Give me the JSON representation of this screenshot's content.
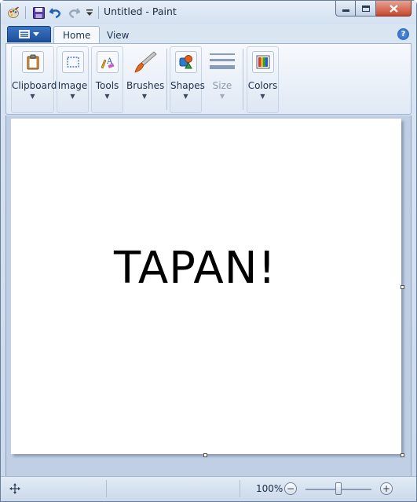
{
  "window": {
    "title": "Untitled - Paint"
  },
  "quick_access": {
    "icons": [
      "paint-app-icon",
      "save-icon",
      "undo-icon",
      "redo-icon",
      "customize-dropdown-icon"
    ]
  },
  "tabs": [
    {
      "label": "Home",
      "active": true
    },
    {
      "label": "View",
      "active": false
    }
  ],
  "ribbon": {
    "groups": [
      {
        "label": "Clipboard",
        "icon": "clipboard-icon"
      },
      {
        "label": "Image",
        "icon": "select-icon"
      },
      {
        "label": "Tools",
        "icon": "tools-icon"
      },
      {
        "label": "Brushes",
        "icon": "brush-icon"
      },
      {
        "label": "Shapes",
        "icon": "shapes-icon"
      },
      {
        "label": "Size",
        "icon": "size-icon",
        "disabled": true
      },
      {
        "label": "Colors",
        "icon": "colors-icon"
      }
    ],
    "dropdown_glyph": "▼"
  },
  "canvas": {
    "text": "TAPAN!",
    "background": "#ffffff"
  },
  "statusbar": {
    "zoom": "100%",
    "zoom_fraction": 0.5,
    "zoom_out_label": "−",
    "zoom_in_label": "+"
  },
  "colors": {
    "accent": "#1c4f9a",
    "close_button": "#c8462f",
    "canvas_bg_area": "#c0cfe4"
  }
}
